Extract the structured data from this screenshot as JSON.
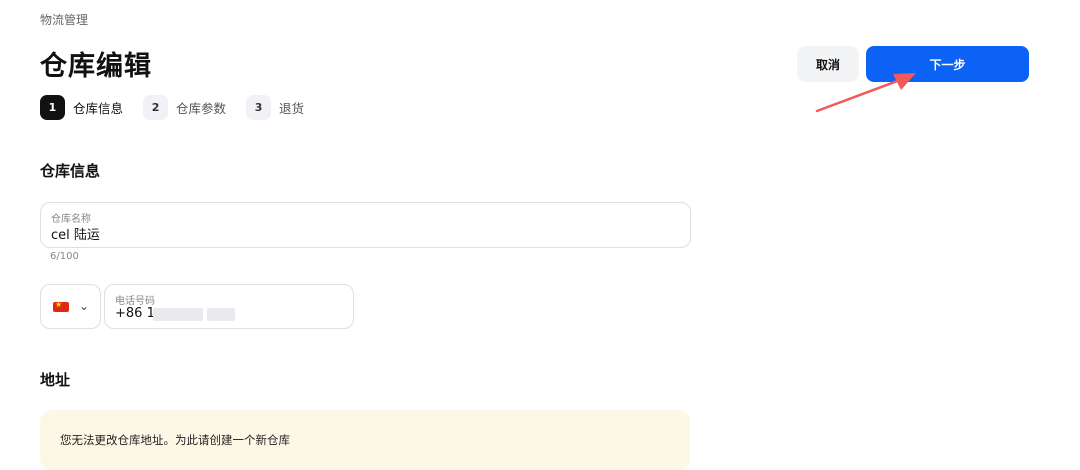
{
  "breadcrumb": "物流管理",
  "header": {
    "title": "仓库编辑",
    "cancel_label": "取消",
    "next_label": "下一步"
  },
  "steps": [
    {
      "num": "1",
      "label": "仓库信息"
    },
    {
      "num": "2",
      "label": "仓库参数"
    },
    {
      "num": "3",
      "label": "退货"
    }
  ],
  "warehouse_info": {
    "section_title": "仓库信息",
    "name_label": "仓库名称",
    "name_value": "cel 陆运",
    "name_counter": "6/100",
    "country_flag_icon": "china-flag-icon",
    "phone_label": "电话号码",
    "phone_value": "+86 1"
  },
  "address": {
    "section_title": "地址",
    "notice": "您无法更改仓库地址。为此请创建一个新仓库"
  },
  "colors": {
    "primary": "#0b62f5",
    "annotation_arrow": "#f05a5a",
    "notice_bg": "#fdf8e6"
  }
}
